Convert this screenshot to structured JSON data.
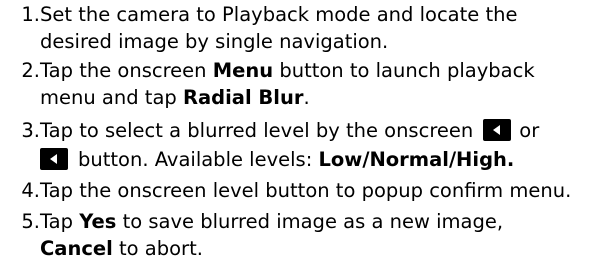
{
  "steps": [
    {
      "number": "1.",
      "line1": "Set the camera to Playback mode and locate the",
      "line2": "desired image by single navigation."
    },
    {
      "number": "2.",
      "line1_a": "Tap the onscreen ",
      "line1_b": "Menu",
      "line1_c": " button to launch playback",
      "line2_a": "menu and tap ",
      "line2_b": "Radial Blur",
      "line2_c": "."
    },
    {
      "number": "3.",
      "line1_a": "Tap to select a blurred level by the onscreen",
      "line1_b": "or",
      "line2_a": "button. Available levels: ",
      "line2_b": "Low/Normal/High."
    },
    {
      "number": "4.",
      "line1": "Tap the onscreen level button to popup confirm menu."
    },
    {
      "number": "5.",
      "line1_a": "Tap ",
      "line1_b": "Yes",
      "line1_c": " to save blurred image as a new image,",
      "line2_a": "Cancel",
      "line2_b": " to abort."
    }
  ],
  "icons": {
    "button_icon": "left-arrow-button-icon"
  }
}
